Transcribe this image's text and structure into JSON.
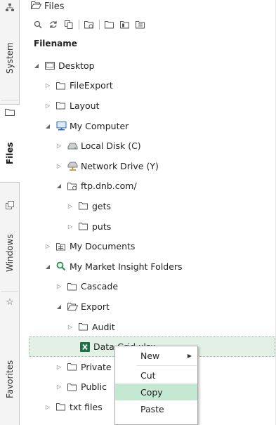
{
  "panel": {
    "title": "Files"
  },
  "rail": {
    "tabs": [
      {
        "label": "System"
      },
      {
        "label": "Files"
      },
      {
        "label": "Windows"
      },
      {
        "label": "Favorites"
      }
    ]
  },
  "toolbar": {
    "icons": [
      "search-icon",
      "refresh-icon",
      "copy-icon",
      "ftp-icon",
      "folder-icon",
      "folder-open-icon",
      "folder-tree-icon"
    ]
  },
  "tree": {
    "column_header": "Filename",
    "items": [
      {
        "label": "Desktop"
      },
      {
        "label": "FileExport"
      },
      {
        "label": "Layout"
      },
      {
        "label": "My Computer"
      },
      {
        "label": "Local Disk (C)"
      },
      {
        "label": "Network Drive (Y)"
      },
      {
        "label": "ftp.dnb.com/"
      },
      {
        "label": "gets"
      },
      {
        "label": "puts"
      },
      {
        "label": "My Documents"
      },
      {
        "label": "My Market Insight Folders"
      },
      {
        "label": "Cascade"
      },
      {
        "label": "Export"
      },
      {
        "label": "Audit"
      },
      {
        "label": "Data Grid.xlsx"
      },
      {
        "label": "Private"
      },
      {
        "label": "Public"
      },
      {
        "label": "txt files"
      }
    ]
  },
  "context_menu": {
    "items": [
      {
        "label": "New"
      },
      {
        "label": "Cut"
      },
      {
        "label": "Copy"
      },
      {
        "label": "Paste"
      }
    ],
    "highlighted": "Copy"
  },
  "colors": {
    "selection_bg": "#e3f0e5",
    "menu_highlight": "#c5e8d2",
    "excel_green": "#1e7145",
    "search_green": "#2e8b57",
    "computer_blue": "#2b6cb0"
  }
}
